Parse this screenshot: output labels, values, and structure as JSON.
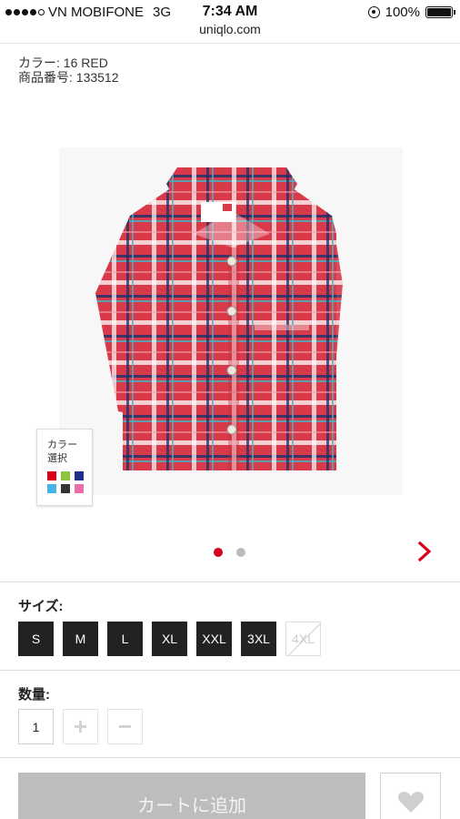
{
  "status_bar": {
    "carrier": "VN MOBIFONE",
    "network": "3G",
    "time": "7:34 AM",
    "battery": "100%"
  },
  "browser": {
    "url": "uniqlo.com"
  },
  "product": {
    "color_line": "カラー: 16 RED",
    "item_number_line": "商品番号: 133512",
    "image_icon": "red-plaid-shirt-image",
    "swatch_label": "カラー選択",
    "swatches": [
      "#d7001a",
      "#8cc63f",
      "#1f2f8a",
      "#47b2e6",
      "#333333",
      "#ea6fa8"
    ]
  },
  "gallery": {
    "active_index": 1,
    "total": 2,
    "next_icon": "chevron-right-icon",
    "accent_color": "#d7001a"
  },
  "size_section": {
    "title": "サイズ:",
    "sizes": [
      {
        "label": "S",
        "available": true
      },
      {
        "label": "M",
        "available": true
      },
      {
        "label": "L",
        "available": true
      },
      {
        "label": "XL",
        "available": true
      },
      {
        "label": "XXL",
        "available": true
      },
      {
        "label": "3XL",
        "available": true
      },
      {
        "label": "4XL",
        "available": false
      }
    ]
  },
  "quantity_section": {
    "title": "数量:",
    "value": "1",
    "increment_label": "+",
    "decrement_label": "−"
  },
  "actions": {
    "add_to_cart_label": "カートに追加",
    "favorite_icon": "heart-icon"
  }
}
